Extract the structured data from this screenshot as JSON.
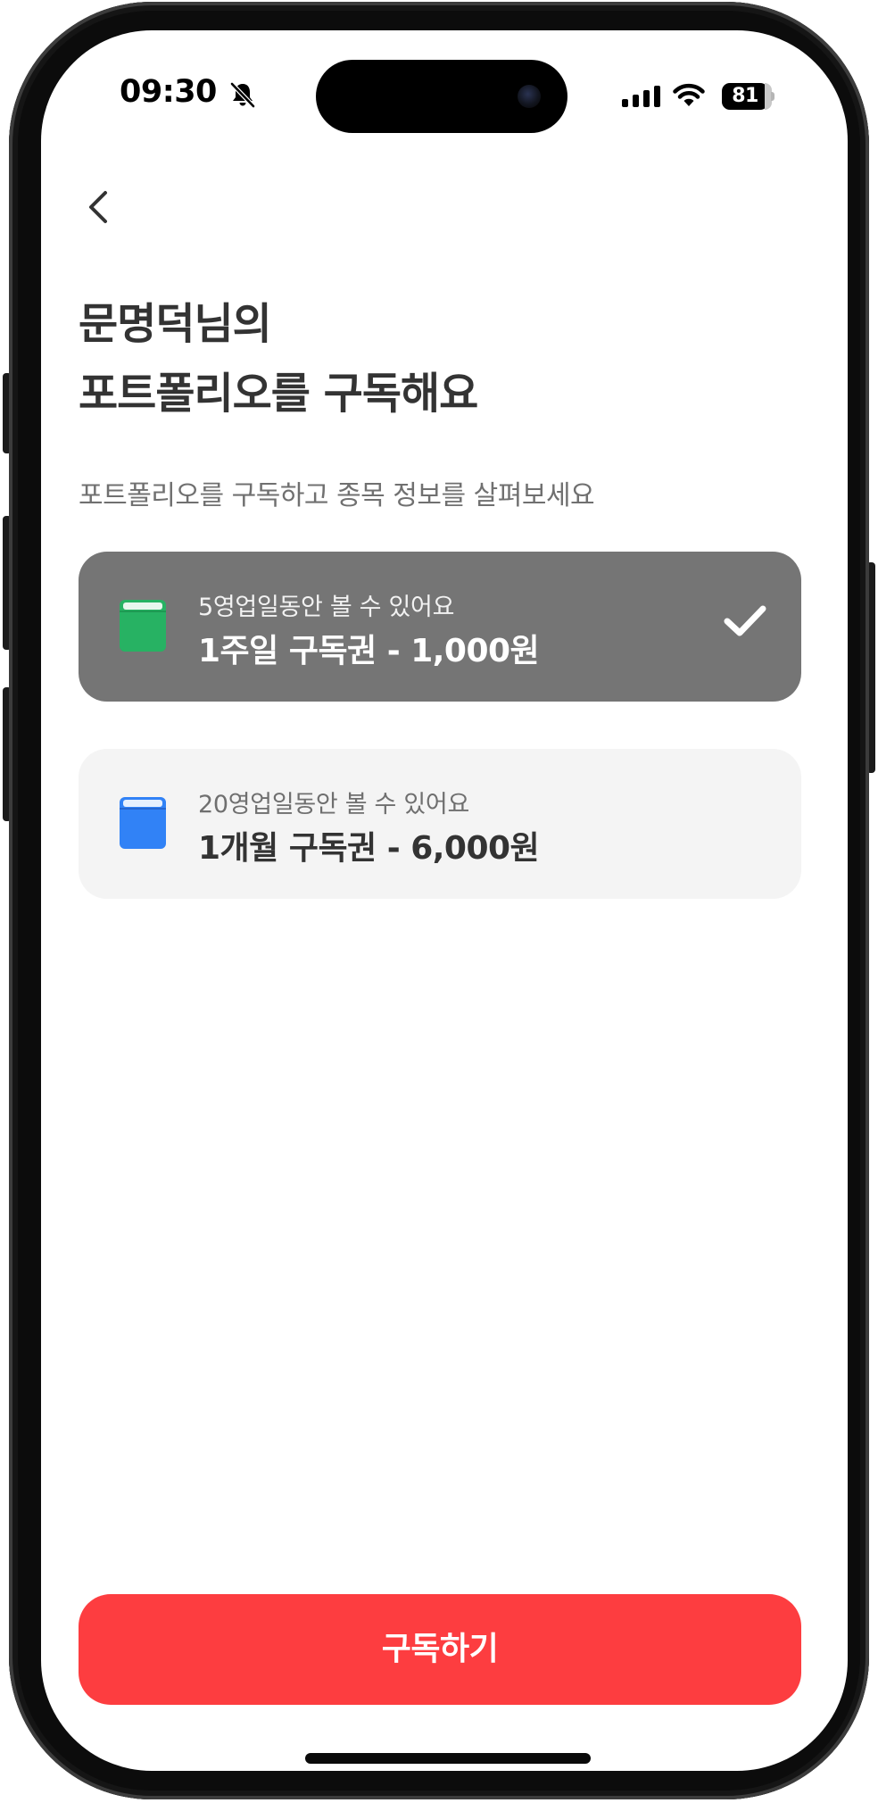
{
  "status_bar": {
    "time": "09:30",
    "battery": "81",
    "icons": [
      "bell-slash-icon",
      "signal-icon",
      "wifi-icon",
      "battery-icon"
    ]
  },
  "header": {
    "back_icon": "chevron-left-icon",
    "title_line1": "문명덕님의",
    "title_line2": "포트폴리오를 구독해요",
    "subtitle": "포트폴리오를 구독하고 종목 정보를 살펴보세요"
  },
  "plans": [
    {
      "description": "5영업일동안 볼 수 있어요",
      "name": "1주일 구독권 - 1,000원",
      "icon": "green-book-icon",
      "icon_color": "#27b263",
      "selected": true
    },
    {
      "description": "20영업일동안 볼 수 있어요",
      "name": "1개월 구독권 - 6,000원",
      "icon": "blue-book-icon",
      "icon_color": "#3182f6",
      "selected": false
    }
  ],
  "colors": {
    "selected_card": "#757575",
    "unselected_card": "#f4f4f4",
    "cta": "#fd3d40"
  },
  "cta": {
    "label": "구독하기"
  }
}
